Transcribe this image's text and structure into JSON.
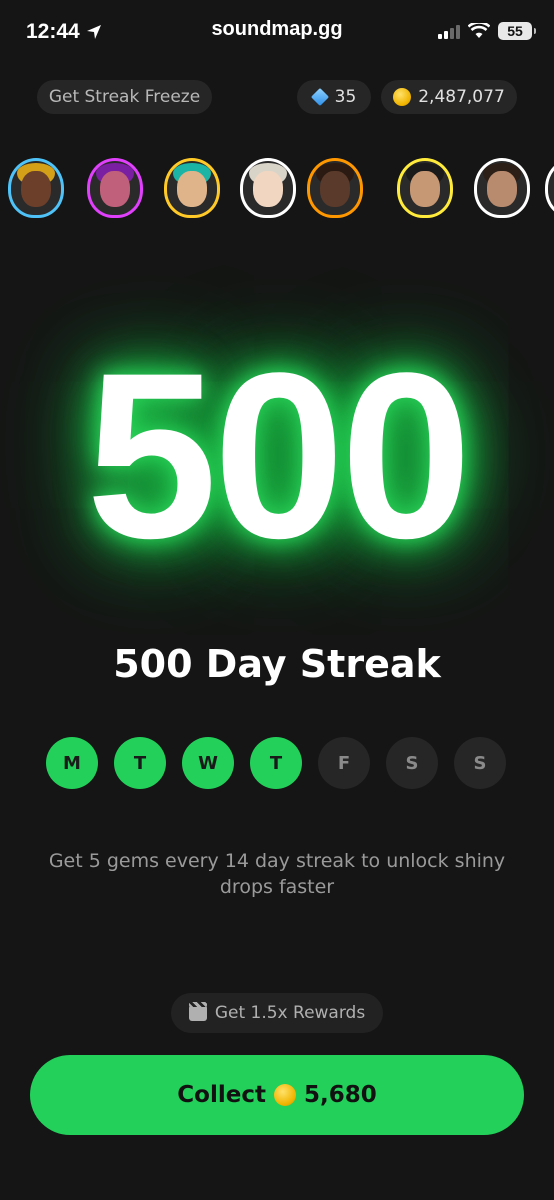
{
  "status_bar": {
    "time": "12:44",
    "url": "soundmap.gg",
    "battery": "55"
  },
  "top": {
    "streak_freeze_label": "Get Streak Freeze",
    "gems": "35",
    "coins": "2,487,077"
  },
  "avatars": [
    {
      "name": "artist-1",
      "border": "#4fc3f7",
      "face": "#6b3f2a",
      "hair": "#d4a017"
    },
    {
      "name": "artist-2",
      "border": "#e040fb",
      "face": "#c0607a",
      "hair": "#7b1fa2"
    },
    {
      "name": "artist-3",
      "border": "#ffca28",
      "face": "#e0b48a",
      "hair": "#1cb5a5"
    },
    {
      "name": "artist-4",
      "border": "#ffffff",
      "face": "#f1d6c2",
      "hair": "#d9d4c8"
    },
    {
      "name": "artist-5",
      "border": "#ff9800",
      "face": "#5a3a2a",
      "hair": "#2a1a12"
    },
    {
      "name": "artist-6",
      "border": "#ffeb3b",
      "face": "#c69874",
      "hair": "#1a1a1a"
    },
    {
      "name": "artist-7",
      "border": "#ffffff",
      "face": "#b98b6e",
      "hair": "#2b1f18"
    },
    {
      "name": "artist-8",
      "border": "#ffffff",
      "face": "#d19a7a",
      "hair": "#3a2a20"
    }
  ],
  "streak": {
    "number": "500",
    "title": "500 Day Streak"
  },
  "days": [
    {
      "letter": "M",
      "done": true
    },
    {
      "letter": "T",
      "done": true
    },
    {
      "letter": "W",
      "done": true
    },
    {
      "letter": "T",
      "done": true
    },
    {
      "letter": "F",
      "done": false
    },
    {
      "letter": "S",
      "done": false
    },
    {
      "letter": "S",
      "done": false
    }
  ],
  "description": "Get 5 gems every 14 day streak to unlock shiny drops faster",
  "rewards_label": "Get 1.5x Rewards",
  "collect": {
    "label": "Collect",
    "amount": "5,680"
  },
  "colors": {
    "accent": "#22d05a",
    "background": "#151515"
  }
}
